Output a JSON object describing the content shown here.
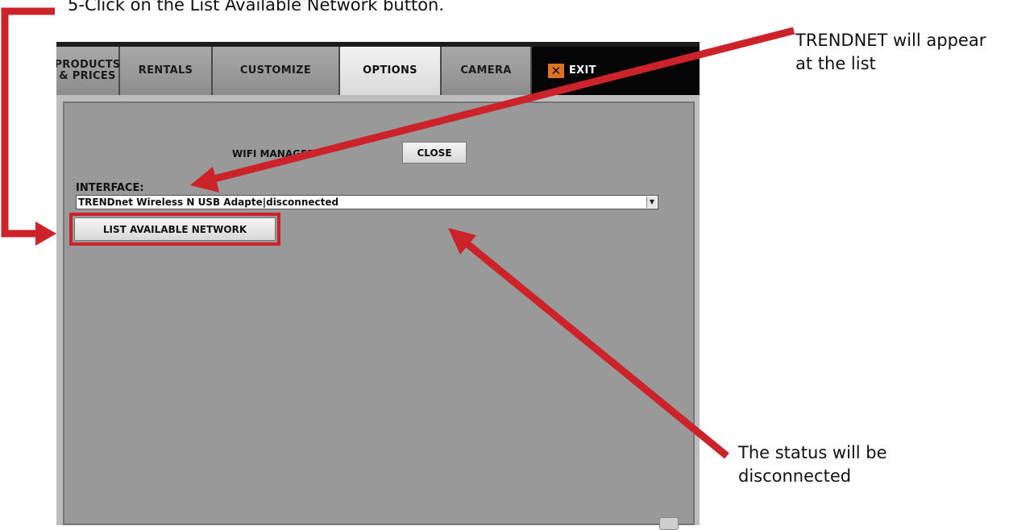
{
  "instructions": {
    "step": "5-Click on the List Available Network button.",
    "note_list": "TRENDNET will appear at the list",
    "note_status": "The status will be disconnected"
  },
  "app": {
    "tabs": [
      {
        "label": "PRODUCTS\n& PRICES",
        "active": false
      },
      {
        "label": "RENTALS",
        "active": false
      },
      {
        "label": "CUSTOMIZE",
        "active": false
      },
      {
        "label": "OPTIONS",
        "active": true
      },
      {
        "label": "CAMERA",
        "active": false
      }
    ],
    "exit_label": "EXIT",
    "wifi": {
      "manager_label": "WIFI MANAGER",
      "close_label": "CLOSE",
      "interface_label": "INTERFACE:",
      "interface_value": "TRENDnet Wireless N USB Adapte|disconnected",
      "list_button": "LIST AVAILABLE NETWORK"
    }
  },
  "colors": {
    "annotation_red": "#cc2229",
    "exit_accent": "#e0731f"
  },
  "icons": {
    "exit": "close-x-icon",
    "dropdown": "chevron-down-icon"
  }
}
